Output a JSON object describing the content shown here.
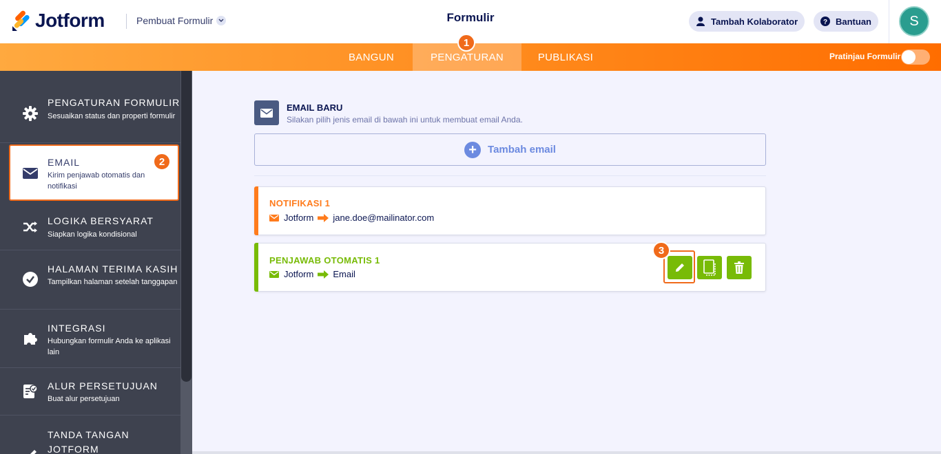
{
  "header": {
    "logo_text": "Jotform",
    "builder_label": "Pembuat Formulir",
    "form_title": "Formulir",
    "collab_label": "Tambah Kolaborator",
    "help_label": "Bantuan",
    "avatar_initial": "S"
  },
  "nav": {
    "tabs": [
      {
        "label": "BANGUN"
      },
      {
        "label": "PENGATURAN",
        "active": true
      },
      {
        "label": "PUBLIKASI"
      }
    ],
    "preview_label": "Pratinjau Formulir",
    "preview_on": false
  },
  "badges": [
    "1",
    "2",
    "3"
  ],
  "sidebar": {
    "items": [
      {
        "title": "PENGATURAN FORMULIR",
        "desc": "Sesuaikan status dan properti formulir",
        "icon": "gear-icon"
      },
      {
        "title": "EMAIL",
        "desc": "Kirim penjawab otomatis dan notifikasi",
        "icon": "envelope-icon",
        "active": true
      },
      {
        "title": "LOGIKA BERSYARAT",
        "desc": "Siapkan logika kondisional",
        "icon": "shuffle-icon"
      },
      {
        "title": "HALAMAN TERIMA KASIH",
        "desc": "Tampilkan halaman setelah tanggapan",
        "icon": "check-circle-icon"
      },
      {
        "title": "INTEGRASI",
        "desc": "Hubungkan formulir Anda ke aplikasi lain",
        "icon": "puzzle-icon"
      },
      {
        "title": "ALUR PERSETUJUAN",
        "desc": "Buat alur persetujuan",
        "icon": "approval-icon"
      },
      {
        "title": "TANDA TANGAN JOTFORM",
        "desc": "",
        "icon": "signature-icon"
      }
    ]
  },
  "main": {
    "new_email_title": "EMAIL BARU",
    "new_email_desc": "Silakan pilih jenis email di bawah ini untuk membuat email Anda.",
    "add_email_label": "Tambah email",
    "cards": [
      {
        "title": "NOTIFIKASI 1",
        "from": "Jotform",
        "to": "jane.doe@mailinator.com",
        "color": "#ff7b1c"
      },
      {
        "title": "PENJAWAB OTOMATIS 1",
        "from": "Jotform",
        "to": "Email",
        "color": "#78bb07"
      }
    ]
  },
  "colors": {
    "brand_navy": "#0a1551",
    "nav_orange": "#ff8a1c",
    "badge_orange": "#f06a1a",
    "sidebar_bg": "#3e424f",
    "action_green": "#78bb07"
  }
}
